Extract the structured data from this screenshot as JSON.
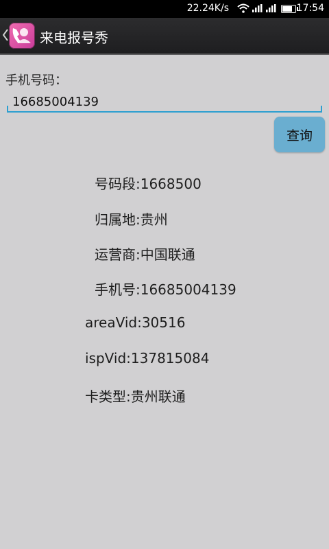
{
  "status_bar": {
    "speed": "22.24K/s",
    "time": "17:54",
    "battery_level": 0.85
  },
  "action_bar": {
    "title": "来电报号秀"
  },
  "form": {
    "label": "手机号码：",
    "phone_value": "16685004139",
    "query_button": "查询"
  },
  "results": {
    "segment": "号码段:1668500",
    "location": "归属地:贵州",
    "carrier": "运营商:中国联通",
    "phone": "手机号:16685004139",
    "area_vid": "areaVid:30516",
    "isp_vid": "ispVid:137815084",
    "card_type": "卡类型:贵州联通"
  }
}
